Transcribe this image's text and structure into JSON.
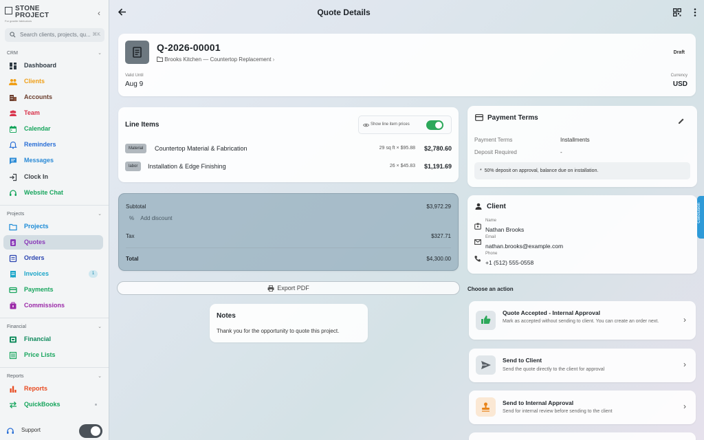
{
  "app": {
    "logo_line1": "STONE",
    "logo_line2": "PROJECT",
    "logo_tagline": "For granite fabricators",
    "search_placeholder": "Search clients, projects, qu...",
    "search_shortcut": "⌘K"
  },
  "sidebar": {
    "sections": [
      {
        "label": "CRM"
      },
      {
        "label": "Projects"
      },
      {
        "label": "Financial"
      },
      {
        "label": "Reports"
      }
    ],
    "items": [
      {
        "label": "Dashboard",
        "color": "#2f3a44",
        "icon": "dashboard-icon"
      },
      {
        "label": "Clients",
        "color": "#f0a019",
        "icon": "clients-icon"
      },
      {
        "label": "Accounts",
        "color": "#6b3e2e",
        "icon": "accounts-icon"
      },
      {
        "label": "Team",
        "color": "#d8324a",
        "icon": "team-icon"
      },
      {
        "label": "Calendar",
        "color": "#17a55d",
        "icon": "calendar-icon"
      },
      {
        "label": "Reminders",
        "color": "#2a6fd6",
        "icon": "reminders-icon"
      },
      {
        "label": "Messages",
        "color": "#2a8ad6",
        "icon": "messages-icon"
      },
      {
        "label": "Clock In",
        "color": "#3a3f44",
        "icon": "clock-in-icon"
      },
      {
        "label": "Website Chat",
        "color": "#17a55d",
        "icon": "website-chat-icon"
      },
      {
        "label": "Projects",
        "color": "#1a8ad6",
        "icon": "projects-icon"
      },
      {
        "label": "Quotes",
        "color": "#8a3bb8",
        "icon": "quotes-icon"
      },
      {
        "label": "Orders",
        "color": "#2a44b0",
        "icon": "orders-icon"
      },
      {
        "label": "Invoices",
        "color": "#1aa5c8",
        "icon": "invoices-icon",
        "badge": "1"
      },
      {
        "label": "Payments",
        "color": "#17a55d",
        "icon": "payments-icon"
      },
      {
        "label": "Commissions",
        "color": "#9b2aa8",
        "icon": "commissions-icon"
      },
      {
        "label": "Financial",
        "color": "#0f8a5c",
        "icon": "financial-icon"
      },
      {
        "label": "Price Lists",
        "color": "#17a55d",
        "icon": "price-lists-icon"
      },
      {
        "label": "Reports",
        "color": "#e84a20",
        "icon": "reports-icon"
      },
      {
        "label": "QuickBooks",
        "color": "#17a55d",
        "icon": "quickbooks-icon"
      }
    ],
    "support_label": "Support"
  },
  "page": {
    "title": "Quote Details"
  },
  "quote": {
    "number": "Q-2026-00001",
    "project": "Brooks Kitchen — Countertop Replacement",
    "status": "Draft",
    "valid_until_label": "Valid Until",
    "valid_until": "Aug 9",
    "currency_label": "Currency",
    "currency": "USD"
  },
  "line_items": {
    "title": "Line Items",
    "show_prices_label": "Show line item prices",
    "show_prices": true,
    "items": [
      {
        "tag": "Material",
        "name": "Countertop Material & Fabrication",
        "qty": "29 sq ft × $95.88",
        "amount": "$2,780.60"
      },
      {
        "tag": "labor",
        "name": "Installation & Edge Finishing",
        "qty": "26 × $45.83",
        "amount": "$1,191.69"
      }
    ]
  },
  "totals": {
    "subtotal_label": "Subtotal",
    "subtotal": "$3,972.29",
    "discount_label": "Add discount",
    "tax_label": "Tax",
    "tax": "$327.71",
    "total_label": "Total",
    "total": "$4,300.00"
  },
  "export_label": "Export PDF",
  "notes": {
    "title": "Notes",
    "body": "Thank you for the opportunity to quote this project."
  },
  "payment_terms": {
    "title": "Payment Terms",
    "terms_label": "Payment Terms",
    "terms_value": "Installments",
    "deposit_label": "Deposit Required",
    "deposit_value": "-",
    "note_prefix": "*",
    "note": "50% deposit on approval, balance due on installation."
  },
  "client": {
    "title": "Client",
    "name_label": "Name",
    "name": "Nathan Brooks",
    "email_label": "Email",
    "email": "nathan.brooks@example.com",
    "phone_label": "Phone",
    "phone": "+1 (512) 555-0558"
  },
  "actions": {
    "heading": "Choose an action",
    "items": [
      {
        "title": "Quote Accepted - Internal Approval",
        "desc": "Mark as accepted without sending to client. You can create an order next.",
        "icon": "thumbs-up-icon",
        "color": "#2ca85a"
      },
      {
        "title": "Send to Client",
        "desc": "Send the quote directly to the client for approval",
        "icon": "send-icon",
        "color": "#5a6168"
      },
      {
        "title": "Send to Internal Approval",
        "desc": "Send for internal review before sending to the client",
        "icon": "stamp-icon",
        "color": "#e8841a"
      }
    ]
  },
  "side_tab_label": "Conclusion"
}
